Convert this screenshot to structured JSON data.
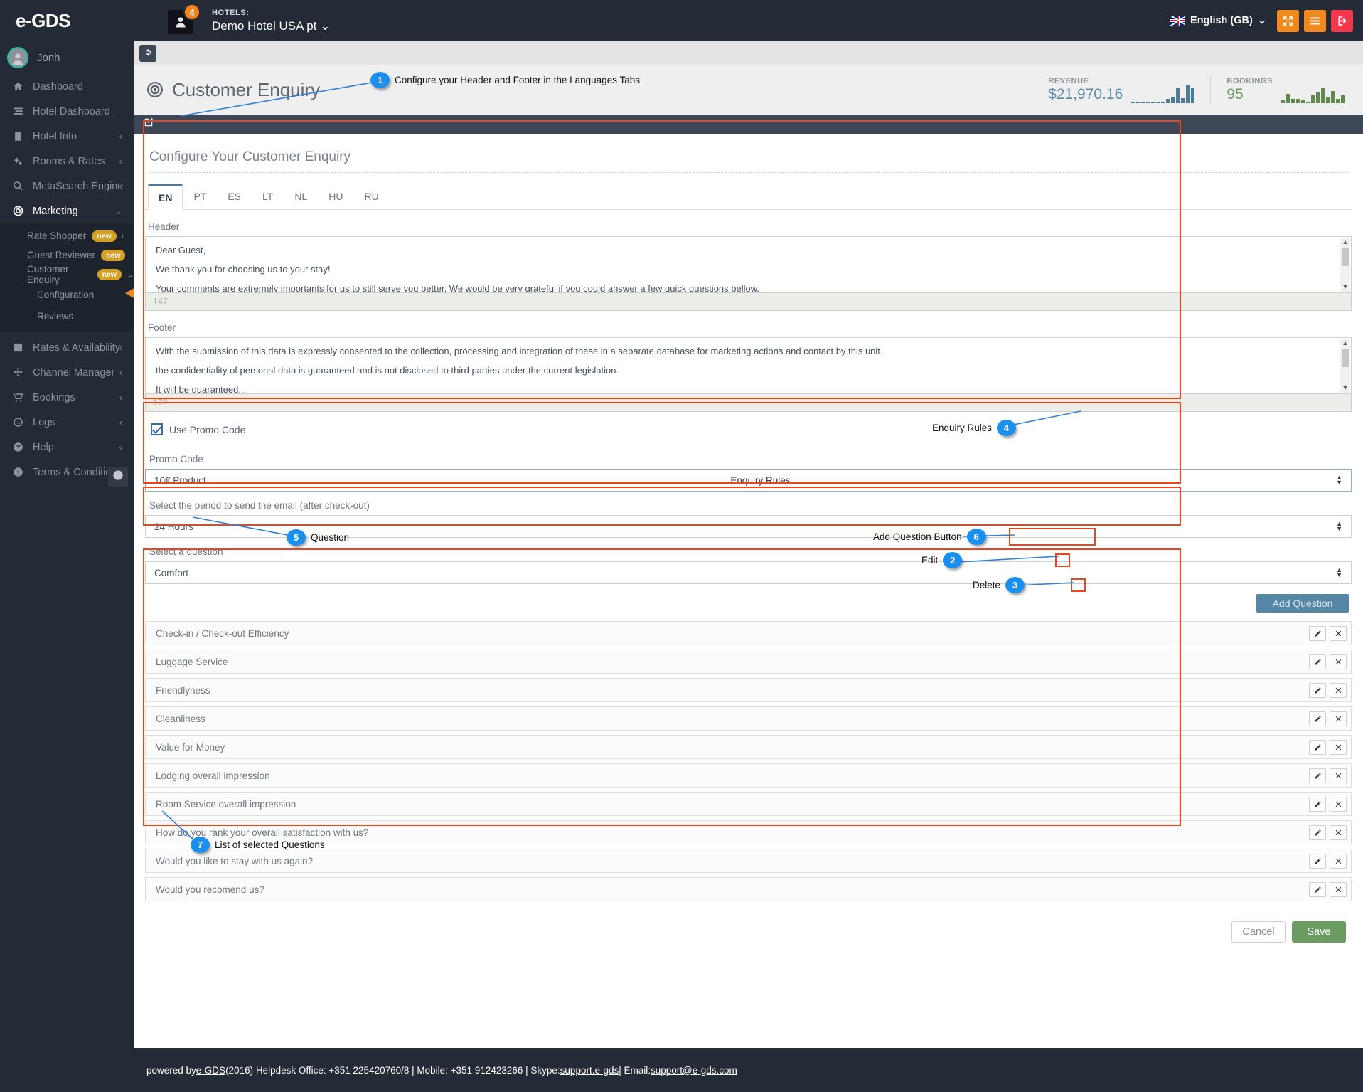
{
  "topbar": {
    "brand": "e-GDS",
    "notification_count": "4",
    "hotels_label": "HOTELS:",
    "hotel_name": "Demo Hotel USA pt",
    "language": "English (GB)",
    "buttons": [
      "expand-icon",
      "menu-icon",
      "logout-icon"
    ]
  },
  "sidebar": {
    "user": "Jonh",
    "items": [
      {
        "label": "Dashboard",
        "icon": "home-icon",
        "chevron": ""
      },
      {
        "label": "Hotel Dashboard",
        "icon": "bars-icon",
        "chevron": ""
      },
      {
        "label": "Hotel Info",
        "icon": "building-icon",
        "chevron": "‹"
      },
      {
        "label": "Rooms & Rates",
        "icon": "gears-icon",
        "chevron": "‹"
      },
      {
        "label": "MetaSearch Engine",
        "icon": "search-icon",
        "chevron": "‹"
      },
      {
        "label": "Marketing",
        "icon": "target-icon",
        "chevron": "⌄",
        "active": true
      }
    ],
    "marketing_sub": [
      {
        "label": "Rate Shopper",
        "badge": "new",
        "chevron": "‹"
      },
      {
        "label": "Guest Reviewer",
        "badge": "new",
        "chevron": ""
      },
      {
        "label": "Customer Enquiry",
        "badge": "new",
        "chevron": "⌄"
      }
    ],
    "enquiry_sub": [
      {
        "label": "Configuration",
        "selected": true
      },
      {
        "label": "Reviews",
        "selected": false
      }
    ],
    "items_bottom": [
      {
        "label": "Rates & Availability",
        "icon": "chart-icon",
        "chevron": "‹"
      },
      {
        "label": "Channel Manager",
        "icon": "arrows-icon",
        "chevron": "‹"
      },
      {
        "label": "Bookings",
        "icon": "cart-icon",
        "chevron": "‹"
      },
      {
        "label": "Logs",
        "icon": "clock-icon",
        "chevron": "‹"
      },
      {
        "label": "Help",
        "icon": "question-icon",
        "chevron": "‹"
      },
      {
        "label": "Terms & Conditions",
        "icon": "exclamation-icon",
        "chevron": ""
      }
    ],
    "collapse_icon": "arrow-left-circle-icon"
  },
  "page": {
    "title": "Customer Enquiry",
    "title_icon": "target-icon",
    "refresh_icon": "refresh-icon",
    "edit_icon": "edit-icon",
    "panel_heading": "Configure Your Customer Enquiry"
  },
  "stats": {
    "revenue_label": "REVENUE",
    "revenue_value": "$21,970.16",
    "bookings_label": "BOOKINGS",
    "bookings_value": "95",
    "revenue_color": "#5c8ba8",
    "bookings_color": "#6f9c5c"
  },
  "chart_data": [
    {
      "type": "bar",
      "title": "REVENUE",
      "categories": [
        "1",
        "2",
        "3",
        "4",
        "5",
        "6",
        "7",
        "8",
        "9",
        "10",
        "11",
        "12",
        "13"
      ],
      "values": [
        1,
        1,
        1,
        1,
        1,
        1,
        1,
        3,
        5,
        12,
        4,
        14,
        11
      ],
      "ylim": [
        0,
        15
      ],
      "xlabel": "",
      "ylabel": "",
      "color": "#4a7d95"
    },
    {
      "type": "bar",
      "title": "BOOKINGS",
      "categories": [
        "1",
        "2",
        "3",
        "4",
        "5",
        "6",
        "7",
        "8",
        "9",
        "10",
        "11",
        "12",
        "13"
      ],
      "values": [
        2,
        7,
        3,
        3,
        2,
        1,
        6,
        8,
        12,
        5,
        9,
        3,
        6
      ],
      "ylim": [
        0,
        15
      ],
      "xlabel": "",
      "ylabel": "",
      "color": "#5d8c4a"
    }
  ],
  "tabs": [
    {
      "label": "EN",
      "active": true
    },
    {
      "label": "PT",
      "active": false
    },
    {
      "label": "ES",
      "active": false
    },
    {
      "label": "LT",
      "active": false
    },
    {
      "label": "NL",
      "active": false
    },
    {
      "label": "HU",
      "active": false
    },
    {
      "label": "RU",
      "active": false
    }
  ],
  "header_field": {
    "label": "Header",
    "line1": "Dear Guest,",
    "line2": "We thank you for choosing us to your stay!",
    "line3": "Your comments are extremely importants for us to still serve you better. We would be very grateful if you could answer a few quick questions bellow.",
    "char_count": "147"
  },
  "footer_field": {
    "label": "Footer",
    "line1": "With the submission of this data is expressly consented to the collection, processing and integration of these in a separate database for marketing actions and contact by this unit.",
    "line2": "the confidentiality of personal data is guaranteed and is not disclosed to third parties under the current legislation.",
    "line3": "It will be guaranteed...",
    "char_count": "172"
  },
  "promo": {
    "checkbox_label": "Use Promo Code",
    "checked": true,
    "code_label": "Promo Code",
    "code_value": "10€ Product",
    "enquiry_rules_label": "Enquiry Rules",
    "period_label": "Select the period to send the email (after check-out)",
    "period_value": "24 Hours"
  },
  "question_select": {
    "label": "Select a question",
    "value": "Comfort"
  },
  "add_question": {
    "button_label": "Add Question"
  },
  "questions": [
    "Check-in / Check-out Efficiency",
    "Luggage Service",
    "Friendlyness",
    "Cleanliness",
    "Value for Money",
    "Lodging overall impression",
    "Room Service overall impression",
    "How do you rank your overall satisfaction with us?",
    "Would you like to stay with us again?",
    "Would you recomend us?"
  ],
  "actions": {
    "cancel": "Cancel",
    "save": "Save"
  },
  "annotations": [
    {
      "num": "1",
      "text": "Configure your Header and Footer in the Languages Tabs"
    },
    {
      "num": "2",
      "text": "Edit"
    },
    {
      "num": "3",
      "text": "Delete"
    },
    {
      "num": "4",
      "text": "Enquiry Rules"
    },
    {
      "num": "5",
      "text": "Question"
    },
    {
      "num": "6",
      "text": "Add Question Button"
    },
    {
      "num": "7",
      "text": "List of selected Questions"
    }
  ],
  "pagefooter": {
    "powered": "powered by ",
    "egds": "e-GDS",
    "year": " (2016) Helpdesk Office: +351 225420760/8 | Mobile: +351 912423266 | Skype: ",
    "skype": "support.e-gds",
    "email_label": " | Email: ",
    "email": "support@e-gds.com"
  },
  "colors": {
    "accent_orange": "#f0891e",
    "annotation_blue": "#1b8ff0",
    "annotation_red": "#f04318",
    "save_green": "#6a9c62",
    "dark": "#242b36"
  }
}
